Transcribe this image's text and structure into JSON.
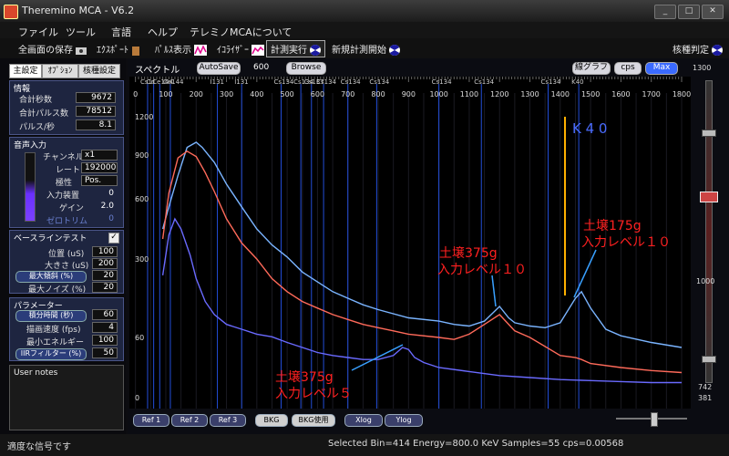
{
  "window": {
    "title": "Theremino MCA - V6.2",
    "controls": [
      "_",
      "□",
      "✕"
    ]
  },
  "menu": [
    "ファイル",
    "ツール",
    "言語",
    "ヘルプ",
    "テレミノMCAについて"
  ],
  "toolbar": {
    "save_screen": "全画面の保存",
    "export": "ｴｸｽﾎﾟｰﾄ",
    "pulse_display": "ﾊﾟﾙｽ表示",
    "equalizer": "ｲｺﾗｲｻﾞｰ",
    "run_measure": "計測実行",
    "new_measure": "新規計測開始",
    "isotope_judge": "核種判定"
  },
  "left_tabs": [
    "主設定",
    "ｵﾌﾟｼｮﾝ",
    "核種設定"
  ],
  "info": {
    "title": "情報",
    "rows": [
      {
        "label": "合計秒数",
        "value": "9672"
      },
      {
        "label": "合計パルス数",
        "value": "78512"
      },
      {
        "label": "パルス/秒",
        "value": "8.1"
      }
    ]
  },
  "audio": {
    "title": "音声入力",
    "rows": [
      {
        "label": "チャンネル",
        "value": "x1"
      },
      {
        "label": "レート",
        "value": "192000"
      },
      {
        "label": "極性",
        "value": "Pos."
      },
      {
        "label": "入力装置",
        "value": "0"
      },
      {
        "label": "ゲイン",
        "value": "2.0"
      },
      {
        "label": "ゼロトリム",
        "value": "0"
      }
    ]
  },
  "baseline": {
    "title": "ベースラインテスト",
    "check": "✓",
    "rows": [
      {
        "label": "位置 (uS)",
        "value": "100"
      },
      {
        "label": "大きさ (uS)",
        "value": "200"
      },
      {
        "label": "最大傾斜 (%)",
        "value": "20"
      },
      {
        "label": "最大ノイズ (%)",
        "value": "20"
      }
    ]
  },
  "params": {
    "title": "パラメーター",
    "rows": [
      {
        "label": "積分時間 (秒)",
        "value": "60"
      },
      {
        "label": "描画速度 (fps)",
        "value": "4"
      },
      {
        "label": "最小エネルギー",
        "value": "100"
      },
      {
        "label": "IIRフィルター (%)",
        "value": "50"
      }
    ]
  },
  "user_notes": "User notes",
  "spectrum_header": {
    "title": "スペクトル",
    "autosave": "AutoSave",
    "autosave_value": "600",
    "browse": "Browse",
    "line_graph": "線グラフ",
    "cps": "cps",
    "max": "Max"
  },
  "bottom": {
    "refs": [
      "Ref 1",
      "Ref 2",
      "Ref 3"
    ],
    "bkg": "BKG",
    "bkg_use": "BKG使用",
    "xlog": "Xlog",
    "ylog": "Ylog"
  },
  "right_scale": {
    "top": "1300",
    "mid": "1000",
    "b1": "742",
    "b2": "381"
  },
  "status": {
    "left": "適度な信号です",
    "right": "Selected Bin=414  Energy=800.0 KeV  Samples=55  cps=0.00568"
  },
  "chart_data": {
    "type": "line",
    "x_ticks": [
      0,
      100,
      200,
      300,
      400,
      500,
      600,
      700,
      800,
      900,
      1000,
      1100,
      1200,
      1300,
      1400,
      1500,
      1600,
      1700,
      1800
    ],
    "y_ticks": [
      0,
      60,
      300,
      600,
      900,
      1200
    ],
    "xlim": [
      -20,
      1830
    ],
    "isotope_labels": [
      {
        "x": 40,
        "text": "Cs1"
      },
      {
        "x": 60,
        "text": "Cd"
      },
      {
        "x": 80,
        "text": "Ce144"
      },
      {
        "x": 115,
        "text": "Ce144"
      },
      {
        "x": 270,
        "text": "I131"
      },
      {
        "x": 350,
        "text": "I131"
      },
      {
        "x": 480,
        "text": "Cs134"
      },
      {
        "x": 545,
        "text": "Cs134"
      },
      {
        "x": 580,
        "text": "Cs137"
      },
      {
        "x": 620,
        "text": "Cs134"
      },
      {
        "x": 700,
        "text": "Cs134"
      },
      {
        "x": 795,
        "text": "Cs134"
      },
      {
        "x": 1000,
        "text": "Cs134"
      },
      {
        "x": 1140,
        "text": "Cs134"
      },
      {
        "x": 1360,
        "text": "Cs134"
      },
      {
        "x": 1461,
        "text": "K40"
      }
    ],
    "annotations": [
      {
        "text": "K 4 0",
        "color": "#4a6cff"
      },
      {
        "text": "土壌175g",
        "color": "#ff2020"
      },
      {
        "text": "入力レベル１０",
        "color": "#ff2020"
      },
      {
        "text": "土壌375g",
        "color": "#ff2020"
      },
      {
        "text": "入力レベル１０",
        "color": "#ff2020"
      },
      {
        "text": "土壌375g",
        "color": "#ff2020"
      },
      {
        "text": "入力レベル５",
        "color": "#ff2020"
      }
    ],
    "series": [
      {
        "color": "#7ab4ff",
        "x": [
          90,
          110,
          140,
          170,
          200,
          220,
          260,
          300,
          350,
          400,
          450,
          500,
          550,
          600,
          650,
          700,
          750,
          800,
          900,
          1000,
          1050,
          1100,
          1150,
          1200,
          1230,
          1250,
          1300,
          1350,
          1400,
          1450,
          1470,
          1500,
          1550,
          1600,
          1700,
          1800
        ],
        "y": [
          450,
          560,
          760,
          960,
          1000,
          960,
          850,
          700,
          560,
          450,
          370,
          310,
          260,
          230,
          200,
          180,
          160,
          145,
          120,
          110,
          100,
          95,
          110,
          155,
          120,
          105,
          95,
          90,
          105,
          180,
          200,
          150,
          85,
          65,
          55,
          50
        ]
      },
      {
        "color": "#ff6a5a",
        "x": [
          90,
          110,
          140,
          170,
          200,
          230,
          260,
          300,
          350,
          400,
          450,
          500,
          550,
          600,
          650,
          700,
          750,
          800,
          850,
          900,
          1000,
          1050,
          1100,
          1150,
          1200,
          1220,
          1250,
          1300,
          1400,
          1450,
          1470,
          1500,
          1600,
          1700,
          1800
        ],
        "y": [
          400,
          640,
          880,
          930,
          890,
          780,
          650,
          500,
          380,
          300,
          240,
          200,
          170,
          150,
          130,
          115,
          100,
          90,
          80,
          70,
          60,
          58,
          70,
          100,
          130,
          110,
          80,
          60,
          42,
          40,
          38,
          34,
          30,
          27,
          25
        ]
      },
      {
        "color": "#6a6aff",
        "x": [
          90,
          110,
          130,
          150,
          180,
          200,
          230,
          260,
          300,
          350,
          400,
          450,
          500,
          550,
          600,
          650,
          700,
          750,
          800,
          850,
          880,
          900,
          920,
          950,
          1000,
          1100,
          1200,
          1300,
          1400,
          1500,
          1600,
          1700,
          1800
        ],
        "y": [
          250,
          420,
          500,
          450,
          320,
          240,
          170,
          130,
          100,
          85,
          70,
          62,
          55,
          50,
          45,
          42,
          40,
          38,
          38,
          42,
          50,
          48,
          40,
          35,
          30,
          26,
          22,
          20,
          18,
          17,
          16,
          15,
          15
        ]
      }
    ]
  }
}
